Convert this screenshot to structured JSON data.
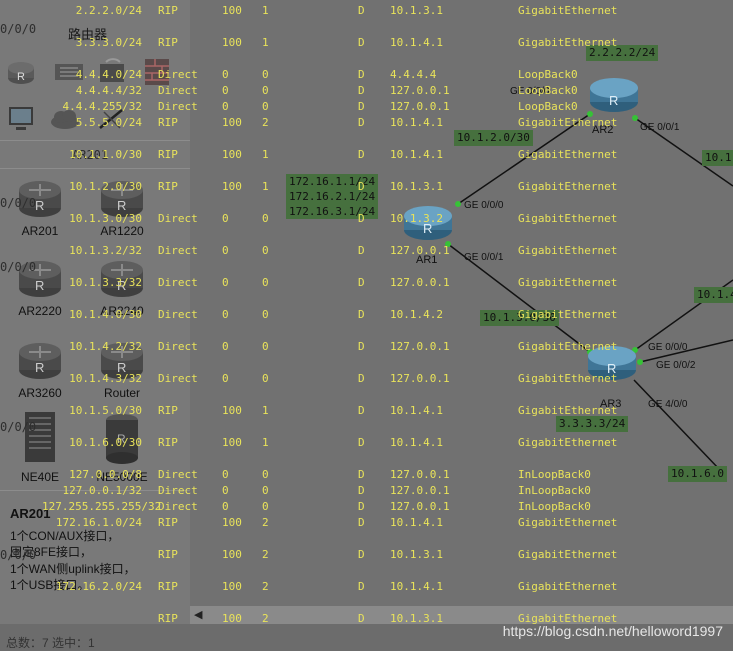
{
  "panel": {
    "category_title": "路由器",
    "tool_icons": [
      "router-icon",
      "switch-icon",
      "wireless-icon",
      "firewall-icon",
      "pc-icon",
      "cloud-icon",
      "cable-icon"
    ],
    "devices": [
      "AR201",
      "AR1220",
      "AR2220",
      "AR2240",
      "AR3260",
      "Router",
      "NE40E",
      "NE5000E"
    ],
    "ghost_item": "AR201",
    "description": {
      "title": "AR201",
      "lines": [
        "1个CON/AUX接口，",
        "固定8FE接口，",
        "1个WAN侧uplink接口，",
        "1个USB接口。"
      ]
    },
    "status": "总数：7  选中：1",
    "ghost_mask": "0/0/0"
  },
  "topology": {
    "nodes": {
      "ar1": "AR1",
      "ar2": "AR2",
      "ar3": "AR3"
    },
    "ports": {
      "ar1_ge000": "GE 0/0/0",
      "ar1_ge001": "GE 0/0/1",
      "ar2_ge000": "GE 0/0/0",
      "ar2_ge001": "GE 0/0/1",
      "ar3_ge000": "GE 0/0/0",
      "ar3_ge002": "GE 0/0/2",
      "ar3_ge400": "GE 4/0/0"
    },
    "ip_labels": {
      "ar2_loop": "2.2.2.2/24",
      "link_ar1_ar2": "10.1.2.0/30",
      "ar1_loops": [
        "172.16.1.1/24",
        "172.16.2.1/24",
        "172.16.3.1/24"
      ],
      "link_ar1_ar3": "10.1.3.0/30",
      "ar3_loop": "3.3.3.3/24",
      "right_top": "10.1.",
      "right_mid": "10.1.4",
      "right_bottom": "10.1.6.0"
    }
  },
  "routing_table": [
    {
      "dest": "2.2.2.0/24",
      "proto": "RIP",
      "pre": "100",
      "cost": "1",
      "flag": "D",
      "hop": "10.1.3.1",
      "iface": "GigabitEthernet"
    },
    {
      "dest": "3.3.3.0/24",
      "proto": "RIP",
      "pre": "100",
      "cost": "1",
      "flag": "D",
      "hop": "10.1.4.1",
      "iface": "GigabitEthernet"
    },
    {
      "dest": "4.4.4.0/24",
      "proto": "Direct",
      "pre": "0",
      "cost": "0",
      "flag": "D",
      "hop": "4.4.4.4",
      "iface": "LoopBack0"
    },
    {
      "dest": "4.4.4.4/32",
      "proto": "Direct",
      "pre": "0",
      "cost": "0",
      "flag": "D",
      "hop": "127.0.0.1",
      "iface": "LoopBack0"
    },
    {
      "dest": "4.4.4.255/32",
      "proto": "Direct",
      "pre": "0",
      "cost": "0",
      "flag": "D",
      "hop": "127.0.0.1",
      "iface": "LoopBack0"
    },
    {
      "dest": "5.5.5.0/24",
      "proto": "RIP",
      "pre": "100",
      "cost": "2",
      "flag": "D",
      "hop": "10.1.4.1",
      "iface": "GigabitEthernet"
    },
    {
      "dest": "10.1.1.0/30",
      "proto": "RIP",
      "pre": "100",
      "cost": "1",
      "flag": "D",
      "hop": "10.1.4.1",
      "iface": "GigabitEthernet"
    },
    {
      "dest": "10.1.2.0/30",
      "proto": "RIP",
      "pre": "100",
      "cost": "1",
      "flag": "D",
      "hop": "10.1.3.1",
      "iface": "GigabitEthernet"
    },
    {
      "dest": "10.1.3.0/30",
      "proto": "Direct",
      "pre": "0",
      "cost": "0",
      "flag": "D",
      "hop": "10.1.3.2",
      "iface": "GigabitEthernet"
    },
    {
      "dest": "10.1.3.2/32",
      "proto": "Direct",
      "pre": "0",
      "cost": "0",
      "flag": "D",
      "hop": "127.0.0.1",
      "iface": "GigabitEthernet"
    },
    {
      "dest": "10.1.3.3/32",
      "proto": "Direct",
      "pre": "0",
      "cost": "0",
      "flag": "D",
      "hop": "127.0.0.1",
      "iface": "GigabitEthernet"
    },
    {
      "dest": "10.1.4.0/30",
      "proto": "Direct",
      "pre": "0",
      "cost": "0",
      "flag": "D",
      "hop": "10.1.4.2",
      "iface": "GigabitEthernet"
    },
    {
      "dest": "10.1.4.2/32",
      "proto": "Direct",
      "pre": "0",
      "cost": "0",
      "flag": "D",
      "hop": "127.0.0.1",
      "iface": "GigabitEthernet"
    },
    {
      "dest": "10.1.4.3/32",
      "proto": "Direct",
      "pre": "0",
      "cost": "0",
      "flag": "D",
      "hop": "127.0.0.1",
      "iface": "GigabitEthernet"
    },
    {
      "dest": "10.1.5.0/30",
      "proto": "RIP",
      "pre": "100",
      "cost": "1",
      "flag": "D",
      "hop": "10.1.4.1",
      "iface": "GigabitEthernet"
    },
    {
      "dest": "10.1.6.0/30",
      "proto": "RIP",
      "pre": "100",
      "cost": "1",
      "flag": "D",
      "hop": "10.1.4.1",
      "iface": "GigabitEthernet"
    },
    {
      "dest": "127.0.0.0/8",
      "proto": "Direct",
      "pre": "0",
      "cost": "0",
      "flag": "D",
      "hop": "127.0.0.1",
      "iface": "InLoopBack0"
    },
    {
      "dest": "127.0.0.1/32",
      "proto": "Direct",
      "pre": "0",
      "cost": "0",
      "flag": "D",
      "hop": "127.0.0.1",
      "iface": "InLoopBack0"
    },
    {
      "dest": "127.255.255.255/32",
      "proto": "Direct",
      "pre": "0",
      "cost": "0",
      "flag": "D",
      "hop": "127.0.0.1",
      "iface": "InLoopBack0"
    },
    {
      "dest": "172.16.1.0/24",
      "proto": "RIP",
      "pre": "100",
      "cost": "2",
      "flag": "D",
      "hop": "10.1.4.1",
      "iface": "GigabitEthernet"
    },
    {
      "dest": "",
      "proto": "RIP",
      "pre": "100",
      "cost": "2",
      "flag": "D",
      "hop": "10.1.3.1",
      "iface": "GigabitEthernet"
    },
    {
      "dest": "172.16.2.0/24",
      "proto": "RIP",
      "pre": "100",
      "cost": "2",
      "flag": "D",
      "hop": "10.1.4.1",
      "iface": "GigabitEthernet"
    },
    {
      "dest": "",
      "proto": "RIP",
      "pre": "100",
      "cost": "2",
      "flag": "D",
      "hop": "10.1.3.1",
      "iface": "GigabitEthernet"
    }
  ],
  "watermark": "https://blog.csdn.net/helloword1997",
  "colors": {
    "table_text": "#e9e35a",
    "ip_box": "#46703e",
    "link_line": "#111111",
    "router_body": "#4f86a8"
  }
}
